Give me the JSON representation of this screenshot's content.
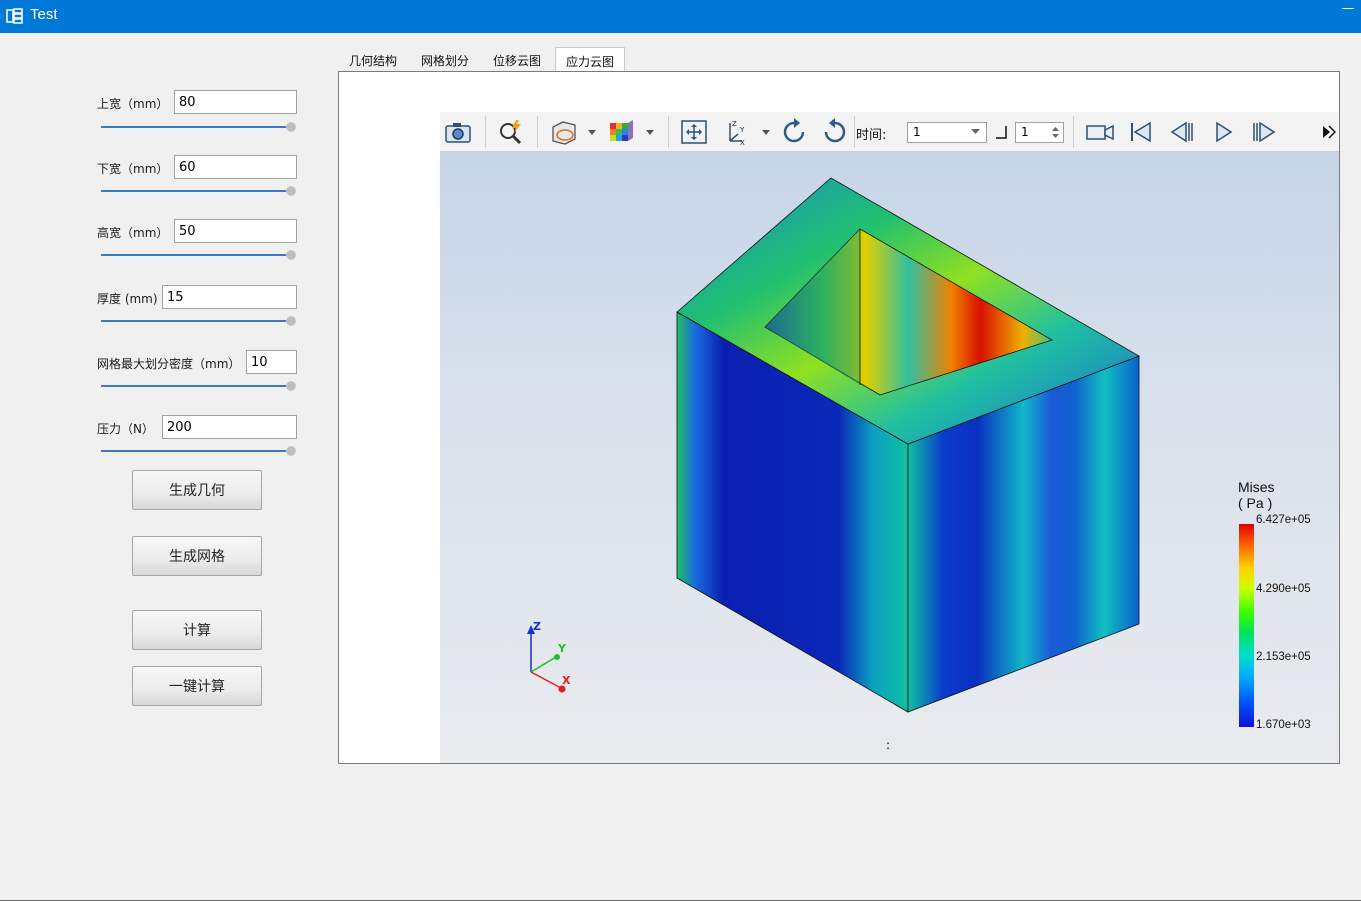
{
  "window": {
    "title": "Test",
    "accent": "#0078d7"
  },
  "params": [
    {
      "label": "上宽（mm）",
      "value": "80"
    },
    {
      "label": "下宽（mm）",
      "value": "60"
    },
    {
      "label": "高宽（mm）",
      "value": "50"
    },
    {
      "label": "厚度 (mm)",
      "value": "15"
    },
    {
      "label": "网格最大划分密度（mm）",
      "value": "10"
    },
    {
      "label": "压力（N）",
      "value": "200"
    }
  ],
  "buttons": {
    "gen_geometry": "生成几何",
    "gen_mesh": "生成网格",
    "compute": "计算",
    "one_click": "一键计算"
  },
  "tabs": [
    "几何结构",
    "网格划分",
    "位移云图",
    "应力云图"
  ],
  "active_tab": "应力云图",
  "toolbar": {
    "time_label": "时间:",
    "time_value": "1",
    "step_value": "1"
  },
  "legend": {
    "title_line1": "Mises",
    "title_line2": "( Pa )",
    "ticks": [
      "6.427e+05",
      "4.290e+05",
      "2.153e+05",
      "1.670e+03"
    ]
  },
  "axes": {
    "z": "Z",
    "y": "Y",
    "x": "X"
  },
  "status": ":"
}
